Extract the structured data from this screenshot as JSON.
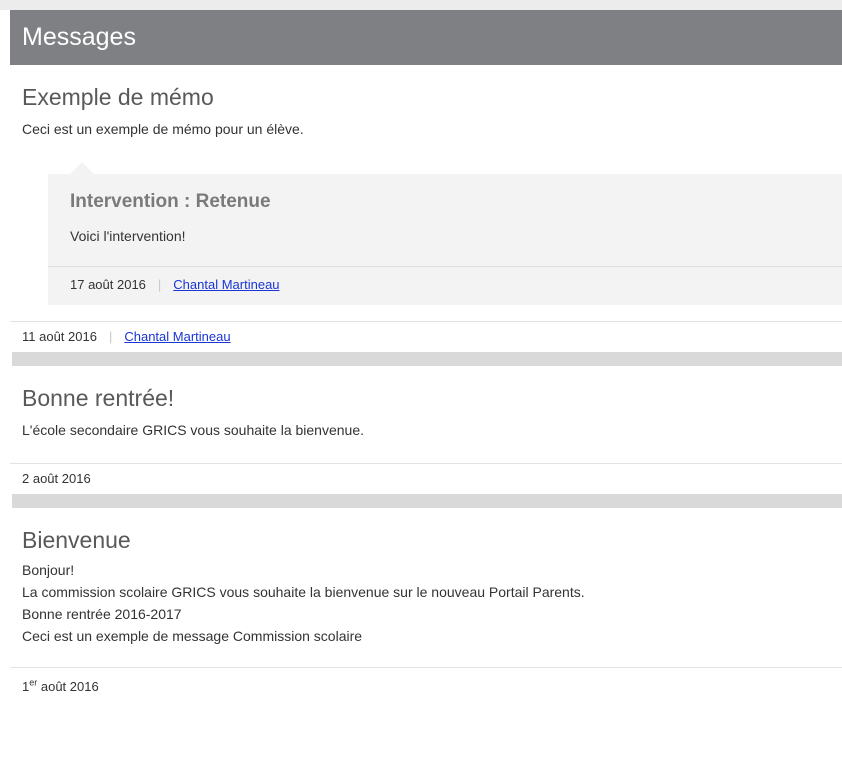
{
  "header": {
    "title": "Messages"
  },
  "messages": [
    {
      "title": "Exemple de mémo",
      "body": "Ceci est un exemple de mémo pour un élève.",
      "intervention": {
        "title": "Intervention : Retenue",
        "body": "Voici l'intervention!",
        "date": "17 août 2016",
        "author": "Chantal Martineau"
      },
      "date": "11 août 2016",
      "author": "Chantal Martineau"
    },
    {
      "title": "Bonne rentrée!",
      "body": "L'école secondaire GRICS vous souhaite la bienvenue.",
      "date": "2 août 2016"
    },
    {
      "title": "Bienvenue",
      "lines": [
        "Bonjour!",
        "La commission scolaire GRICS vous souhaite la bienvenue sur le nouveau Portail Parents.",
        "Bonne rentrée 2016-2017",
        "Ceci est un exemple de message Commission scolaire"
      ],
      "date_day": "1",
      "date_suffix": "er",
      "date_rest": " août 2016"
    }
  ]
}
